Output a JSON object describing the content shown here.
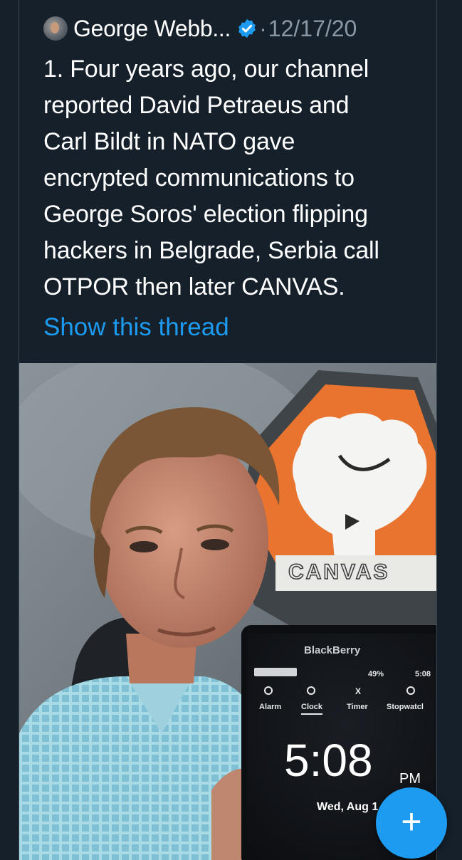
{
  "tweet": {
    "author_name": "George Webb...",
    "separator": "·",
    "date": "12/17/20",
    "text_lines": [
      "1. Four years ago, our channel",
      "reported David Petraeus and",
      "Carl Bildt in NATO gave",
      "encrypted communications to",
      "George Soros' election flipping",
      "hackers in Belgrade, Serbia call",
      "OTPOR then later CANVAS."
    ],
    "show_thread": "Show this thread"
  },
  "media": {
    "sign_text": "CANVAS",
    "phone": {
      "brand": "BlackBerry",
      "status_battery": "49%",
      "status_time": "5:08",
      "tabs": [
        "Alarm",
        "Clock",
        "Timer",
        "Stopwatcl"
      ],
      "clock_time": "5:08",
      "clock_ampm": "PM",
      "clock_date": "Wed, Aug 1"
    }
  },
  "fab": {
    "label": "+"
  },
  "colors": {
    "background": "#15202b",
    "accent": "#1d9bf0",
    "secondary_text": "#8b98a5",
    "sign_orange": "#e8742f"
  }
}
